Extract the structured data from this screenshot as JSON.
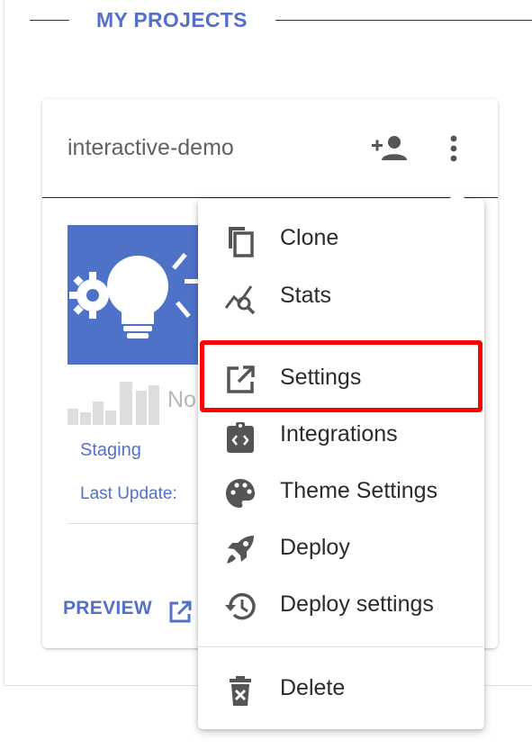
{
  "section": {
    "title": "MY PROJECTS"
  },
  "project": {
    "name": "interactive-demo",
    "chart_placeholder": "No",
    "environment": "Staging",
    "last_update_label": "Last Update:",
    "preview_label": "PREVIEW"
  },
  "menu": {
    "items": [
      {
        "label": "Clone",
        "icon": "copy-icon"
      },
      {
        "label": "Stats",
        "icon": "stats-search-icon"
      },
      {
        "label": "Settings",
        "icon": "open-external-icon"
      },
      {
        "label": "Integrations",
        "icon": "code-clipboard-icon"
      },
      {
        "label": "Theme Settings",
        "icon": "palette-icon"
      },
      {
        "label": "Deploy",
        "icon": "rocket-icon"
      },
      {
        "label": "Deploy settings",
        "icon": "history-icon"
      },
      {
        "label": "Delete",
        "icon": "trash-icon"
      }
    ],
    "highlighted": "Settings"
  },
  "colors": {
    "accent": "#5570c9",
    "thumbnail": "#4f72c9",
    "highlight": "#ff0000",
    "icon": "#555555"
  }
}
